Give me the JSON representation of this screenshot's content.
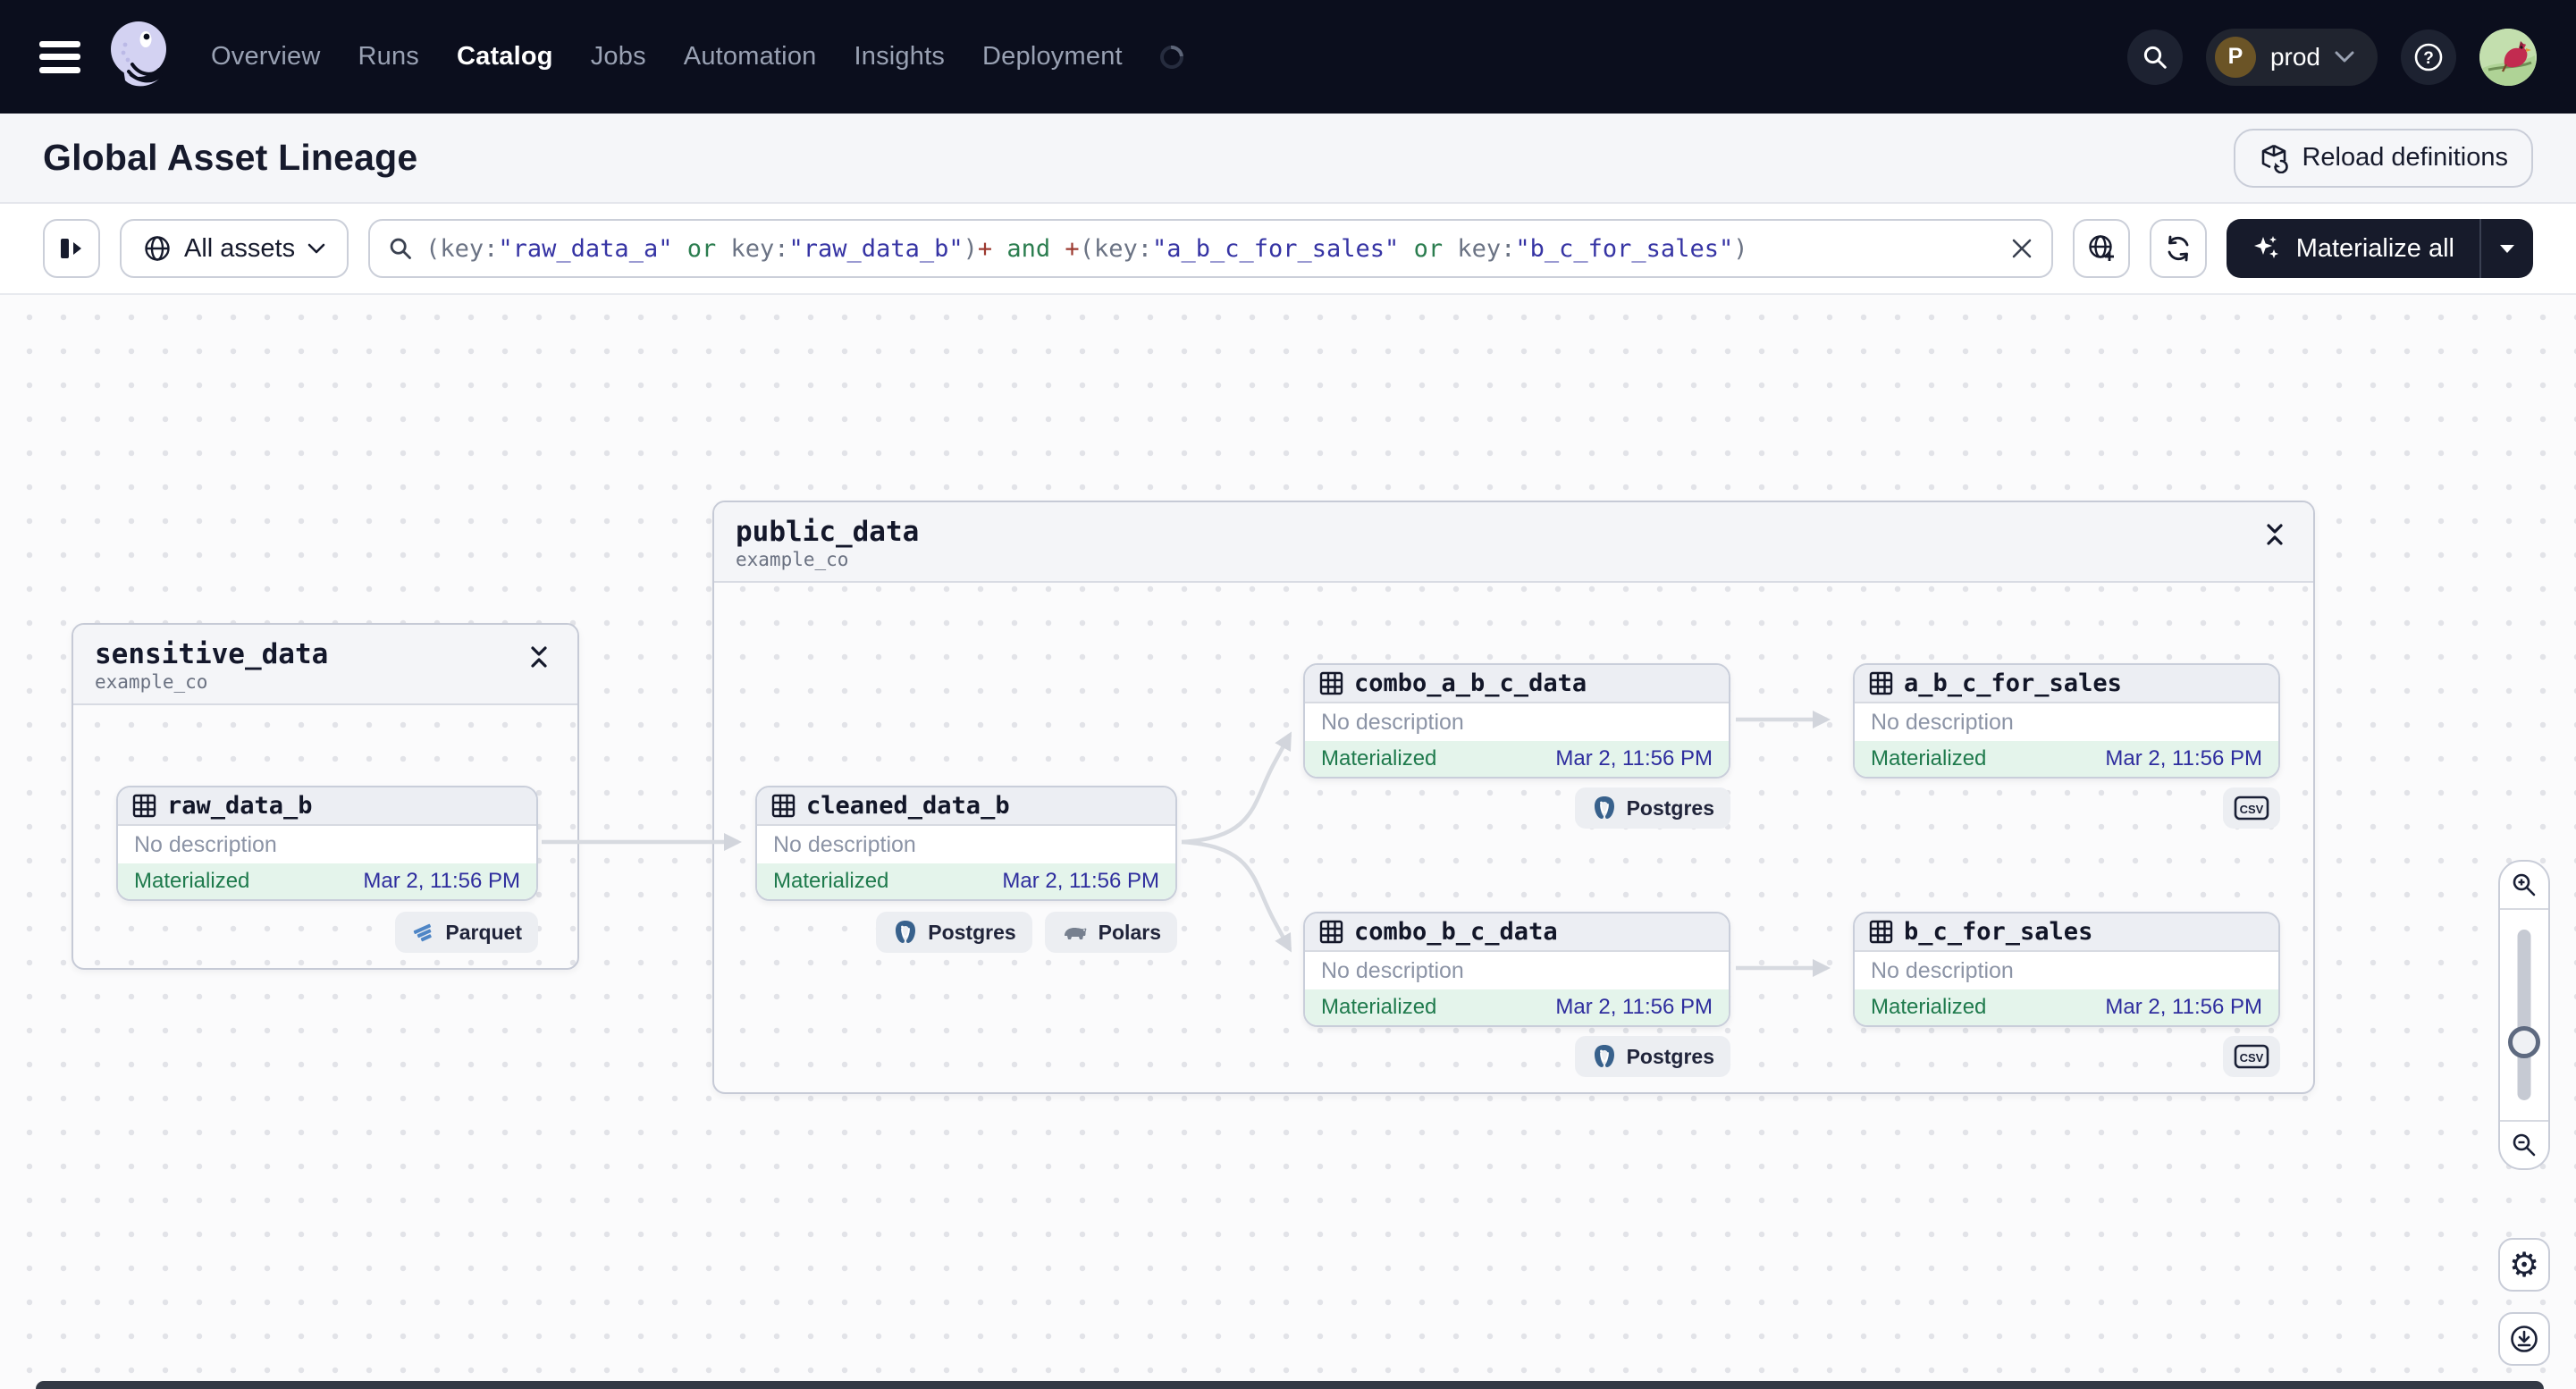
{
  "nav": {
    "items": [
      {
        "label": "Overview"
      },
      {
        "label": "Runs"
      },
      {
        "label": "Catalog"
      },
      {
        "label": "Jobs"
      },
      {
        "label": "Automation"
      },
      {
        "label": "Insights"
      },
      {
        "label": "Deployment"
      }
    ],
    "active_item": "Catalog",
    "environment": {
      "initial": "P",
      "name": "prod"
    }
  },
  "header": {
    "title": "Global Asset Lineage",
    "reload_label": "Reload definitions"
  },
  "toolbar": {
    "scope_label": "All assets",
    "materialize_label": "Materialize all",
    "query": {
      "full_text": "(key:\"raw_data_a\" or key:\"raw_data_b\")+ and +(key:\"a_b_c_for_sales\" or key:\"b_c_for_sales\")",
      "segments": [
        {
          "text": "(key:",
          "type": "punct"
        },
        {
          "text": "\"raw_data_a\"",
          "type": "string"
        },
        {
          "text": " or ",
          "type": "op"
        },
        {
          "text": "key:",
          "type": "punct"
        },
        {
          "text": "\"raw_data_b\"",
          "type": "string"
        },
        {
          "text": ")",
          "type": "punct"
        },
        {
          "text": "+",
          "type": "plus"
        },
        {
          "text": " and ",
          "type": "op"
        },
        {
          "text": "+",
          "type": "plus"
        },
        {
          "text": "(key:",
          "type": "punct"
        },
        {
          "text": "\"a_b_c_for_sales\"",
          "type": "string"
        },
        {
          "text": " or ",
          "type": "op"
        },
        {
          "text": "key:",
          "type": "punct"
        },
        {
          "text": "\"b_c_for_sales\"",
          "type": "string"
        },
        {
          "text": ")",
          "type": "punct"
        }
      ]
    }
  },
  "graph": {
    "groups": [
      {
        "name": "sensitive_data",
        "location": "example_co"
      },
      {
        "name": "public_data",
        "location": "example_co"
      }
    ],
    "nodes": [
      {
        "name": "raw_data_b",
        "description": "No description",
        "status": "Materialized",
        "materialized_at": "Mar 2, 11:56 PM",
        "tags": [
          {
            "label": "Parquet"
          }
        ]
      },
      {
        "name": "cleaned_data_b",
        "description": "No description",
        "status": "Materialized",
        "materialized_at": "Mar 2, 11:56 PM",
        "tags": [
          {
            "label": "Postgres"
          },
          {
            "label": "Polars"
          }
        ]
      },
      {
        "name": "combo_a_b_c_data",
        "description": "No description",
        "status": "Materialized",
        "materialized_at": "Mar 2, 11:56 PM",
        "tags": [
          {
            "label": "Postgres"
          }
        ]
      },
      {
        "name": "a_b_c_for_sales",
        "description": "No description",
        "status": "Materialized",
        "materialized_at": "Mar 2, 11:56 PM",
        "tags": [
          {
            "label": "CSV"
          }
        ]
      },
      {
        "name": "combo_b_c_data",
        "description": "No description",
        "status": "Materialized",
        "materialized_at": "Mar 2, 11:56 PM",
        "tags": [
          {
            "label": "Postgres"
          }
        ]
      },
      {
        "name": "b_c_for_sales",
        "description": "No description",
        "status": "Materialized",
        "materialized_at": "Mar 2, 11:56 PM",
        "tags": [
          {
            "label": "CSV"
          }
        ]
      }
    ]
  },
  "colors": {
    "nav_bg": "#0B0E1D",
    "accent_dark": "#171B2B",
    "materialized_green": "#1E7A4C",
    "materialized_bg": "#E4F4EB",
    "timestamp_navy": "#2E2D9E",
    "query_string": "#3634A4",
    "query_operator": "#2B7D4F",
    "query_plus": "#9C3A30"
  }
}
